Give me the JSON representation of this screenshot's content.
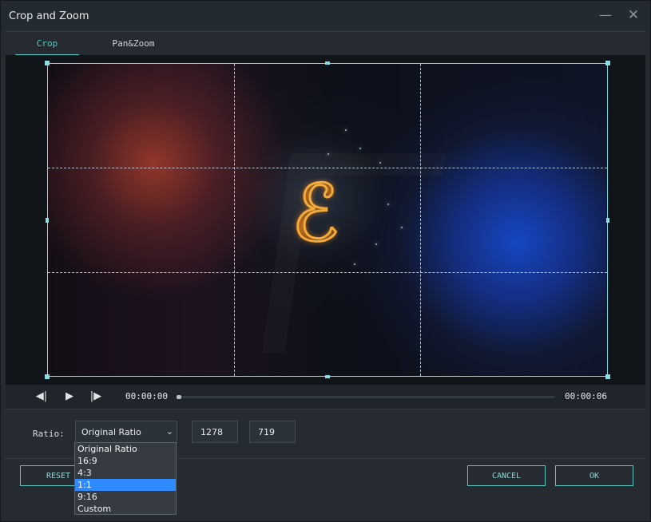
{
  "window": {
    "title": "Crop and Zoom",
    "minimize_icon": "—",
    "close_icon": "✕"
  },
  "tabs": [
    {
      "label": "Crop"
    },
    {
      "label": "Pan&Zoom"
    }
  ],
  "playback": {
    "start_time": "00:00:00",
    "end_time": "00:00:06",
    "progress": 0.0
  },
  "ratio": {
    "label": "Ratio:",
    "selected": "Original Ratio",
    "width": "1278",
    "height": "719",
    "options": [
      "Original Ratio",
      "16:9",
      "4:3",
      "1:1",
      "9:16",
      "Custom"
    ],
    "highlighted_option": "1:1"
  },
  "buttons": {
    "reset": "RESET",
    "cancel": "CANCEL",
    "ok": "OK"
  },
  "colors": {
    "accent": "#58c7c1",
    "selection": "#2f89ff"
  }
}
